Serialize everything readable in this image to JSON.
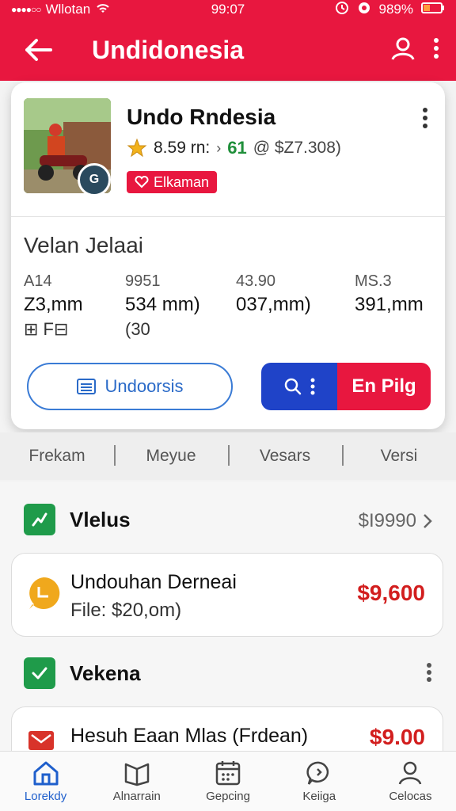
{
  "status_bar": {
    "carrier": "Wllotan",
    "time": "99:07",
    "battery": "989%"
  },
  "app_bar": {
    "title": "Undidonesia"
  },
  "product": {
    "name": "Undo Rndesia",
    "rating": "8.59 rn:",
    "meta_count": "61",
    "meta_price": "@ $Z7.308)",
    "tag": "Elkaman",
    "thumb_badge": "G"
  },
  "details": {
    "section_title": "Velan Jelaai",
    "stats": [
      {
        "label": "A14",
        "value": "Z3,mm",
        "sub": "⊞ F⊟"
      },
      {
        "label": "9951",
        "value": "534 mm)",
        "sub": "(30"
      },
      {
        "label": "43.90",
        "value": "037,mm)",
        "sub": ""
      },
      {
        "label": "MS.3",
        "value": "391,mm",
        "sub": ""
      }
    ],
    "outline_button": "Undoorsis",
    "split_button": "En Pilg"
  },
  "segment_tabs": [
    "Frekam",
    "Meyue",
    "Vesars",
    "Versi"
  ],
  "list": {
    "section1": {
      "title": "Vlelus",
      "amount": "$I9990"
    },
    "item1": {
      "title": "Undouhan Derneai",
      "sub_label": "File:",
      "sub_value": "$20,om)",
      "price": "$9,600"
    },
    "section2": {
      "title": "Vekena"
    },
    "item2": {
      "title": "Hesuh Eaan Mlas (Frdean)",
      "price": "$9.00"
    }
  },
  "bottom_nav": [
    {
      "label": "Lorekdy",
      "icon": "home-icon"
    },
    {
      "label": "Alnarrain",
      "icon": "book-icon"
    },
    {
      "label": "Gepcing",
      "icon": "calendar-icon"
    },
    {
      "label": "Keiiga",
      "icon": "chat-icon"
    },
    {
      "label": "Celocas",
      "icon": "person-icon"
    }
  ],
  "colors": {
    "brand": "#e8173f",
    "accent_blue": "#1f43c8",
    "success": "#1f9b4a",
    "price": "#d21e1e"
  }
}
